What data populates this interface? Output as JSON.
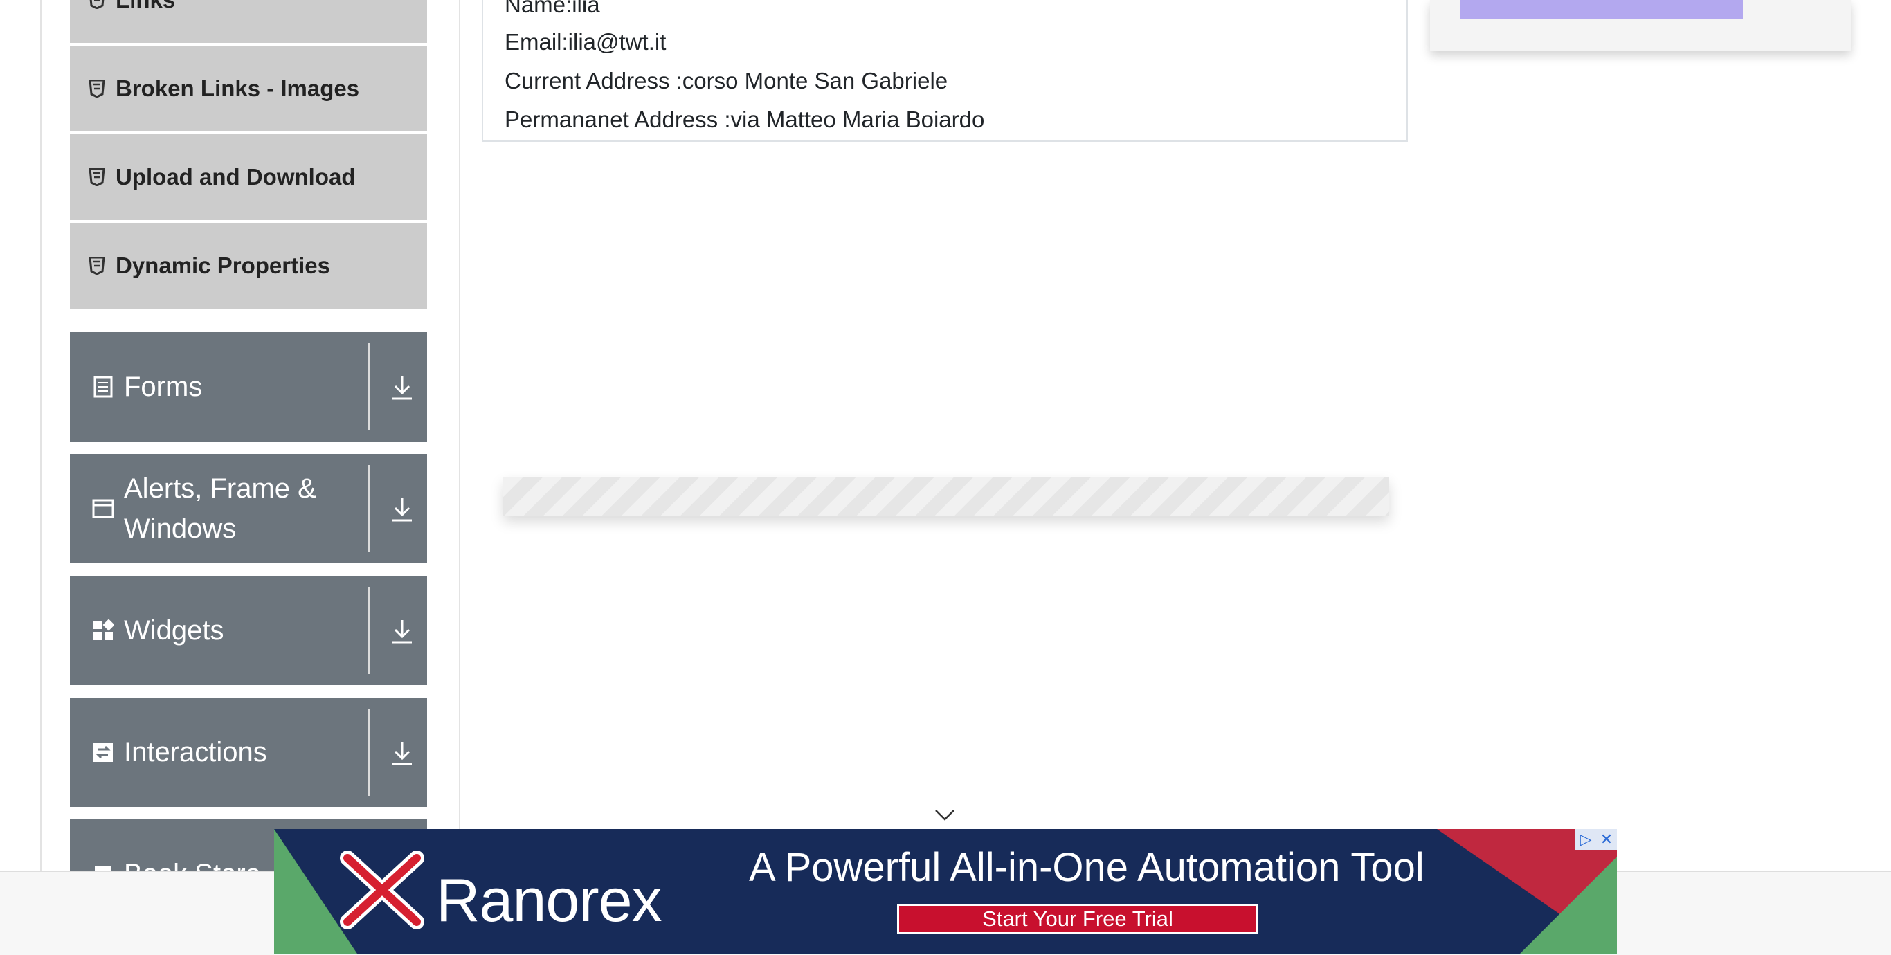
{
  "sidebar": {
    "sub_items": [
      {
        "label": "Links",
        "icon": "html5-icon"
      },
      {
        "label": "Broken Links - Images",
        "icon": "html5-icon"
      },
      {
        "label": "Upload and Download",
        "icon": "html5-icon"
      },
      {
        "label": "Dynamic Properties",
        "icon": "html5-icon"
      }
    ],
    "groups": [
      {
        "label": "Forms",
        "icon": "form-icon"
      },
      {
        "label": "Alerts, Frame & Windows",
        "icon": "window-icon"
      },
      {
        "label": "Widgets",
        "icon": "widgets-icon"
      },
      {
        "label": "Interactions",
        "icon": "interactions-icon"
      },
      {
        "label": "Book Store",
        "icon": "bookstore-icon"
      }
    ]
  },
  "output": {
    "name": "Name:ilia",
    "email": "Email:ilia@twt.it",
    "current_address": "Current Address :corso Monte San Gabriele",
    "permanent_address": "Permananet Address :via Matteo Maria Boiardo"
  },
  "ad_banner": {
    "brand": "Ranorex",
    "headline": "A Powerful All-in-One Automation Tool",
    "cta": "Start Your Free Trial"
  },
  "colors": {
    "sidebar_sub_bg": "#cccccc",
    "sidebar_group_bg": "#6c757d",
    "banner_bg": "#172b59",
    "cta_red": "#c8102e"
  }
}
